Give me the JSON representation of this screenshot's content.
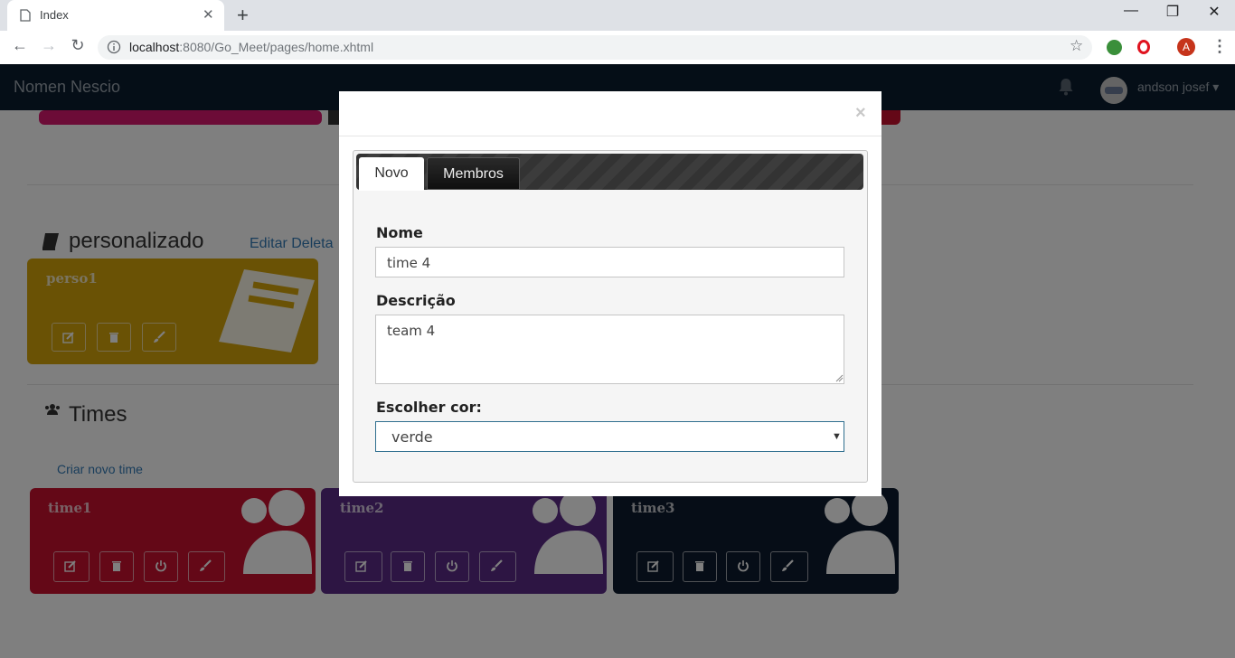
{
  "browser": {
    "tab_title": "Index",
    "url_host": "localhost",
    "url_rest": ":8080/Go_Meet/pages/home.xhtml",
    "profile_initial": "A"
  },
  "navbar": {
    "brand": "Nomen Nescio",
    "user_name": "andson josef"
  },
  "personalizado": {
    "title": "personalizado",
    "actions": "Editar Deleta",
    "cards": [
      {
        "name": "perso1",
        "color": "#d4a40a"
      }
    ]
  },
  "times": {
    "title": "Times",
    "create_link": "Criar novo time",
    "cards": [
      {
        "name": "time1",
        "color": "#c8102e"
      },
      {
        "name": "time2",
        "color": "#5b2a86"
      },
      {
        "name": "time3",
        "color": "#0d1b2e"
      }
    ]
  },
  "modal": {
    "tabs": [
      "Novo",
      "Membros"
    ],
    "active_tab": "Novo",
    "nome_label": "Nome",
    "nome_value": "time 4",
    "descricao_label": "Descrição",
    "descricao_value": "team 4",
    "cor_label": "Escolher cor:",
    "cor_value": "verde"
  }
}
